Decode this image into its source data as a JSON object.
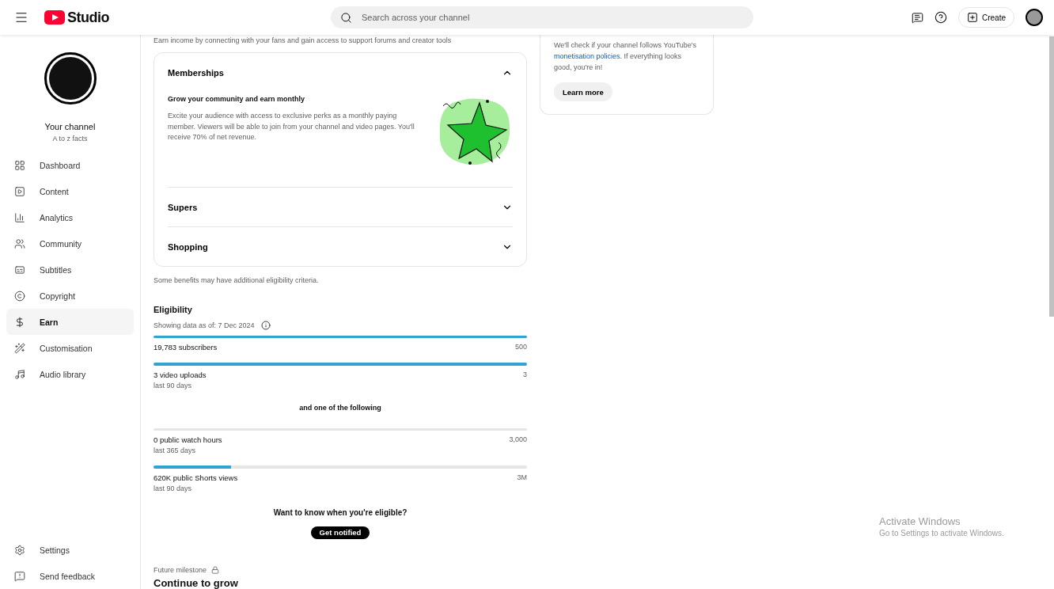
{
  "header": {
    "logo_text": "Studio",
    "search": {
      "placeholder": "Search across your channel"
    },
    "create_label": "Create"
  },
  "sidebar": {
    "channel_title": "Your channel",
    "channel_name": "A to z facts",
    "items": [
      {
        "label": "Dashboard",
        "selected": false
      },
      {
        "label": "Content",
        "selected": false
      },
      {
        "label": "Analytics",
        "selected": false
      },
      {
        "label": "Community",
        "selected": false
      },
      {
        "label": "Subtitles",
        "selected": false
      },
      {
        "label": "Copyright",
        "selected": false
      },
      {
        "label": "Earn",
        "selected": true
      },
      {
        "label": "Customisation",
        "selected": false
      },
      {
        "label": "Audio library",
        "selected": false
      }
    ],
    "footer_items": [
      {
        "label": "Settings"
      },
      {
        "label": "Send feedback"
      }
    ]
  },
  "intro": "Earn income by connecting with your fans and gain access to support forums and creator tools",
  "benefits": [
    {
      "title": "Memberships",
      "expanded": true,
      "subtitle": "Grow your community and earn monthly",
      "body": "Excite your audience with access to exclusive perks as a monthly paying member. Viewers will be able to join from your channel and video pages. You'll receive 70% of net revenue."
    },
    {
      "title": "Supers",
      "expanded": false
    },
    {
      "title": "Shopping",
      "expanded": false
    }
  ],
  "benefits_note": "Some benefits may have additional eligibility criteria.",
  "eligibility": {
    "title": "Eligibility",
    "data_date": "Showing data as of: 7 Dec 2024",
    "required": [
      {
        "label": "19,783 subscribers",
        "target": "500",
        "level": 1
      },
      {
        "label": "3 video uploads",
        "period": "last 90 days",
        "target": "3",
        "level": 1
      }
    ],
    "separator": "and one of the following",
    "optional": [
      {
        "label": "0 public watch hours",
        "period": "last 365 days",
        "target": "3,000",
        "level": 0
      },
      {
        "label": "620K public Shorts views",
        "period": "last 90 days",
        "target": "3M",
        "level": 0.207
      }
    ],
    "notify_question": "Want to know when you're eligible?",
    "notify_button": "Get notified"
  },
  "milestone": {
    "label": "Future milestone",
    "title": "Continue to grow"
  },
  "review_card": {
    "text_before": "We'll check if your channel follows YouTube's",
    "link": "monetisation policies.",
    "text_after": "If everything looks good, you're in!",
    "button": "Learn more"
  },
  "os_watermark": {
    "title": "Activate Windows",
    "subtitle": "Go to Settings to activate Windows."
  }
}
